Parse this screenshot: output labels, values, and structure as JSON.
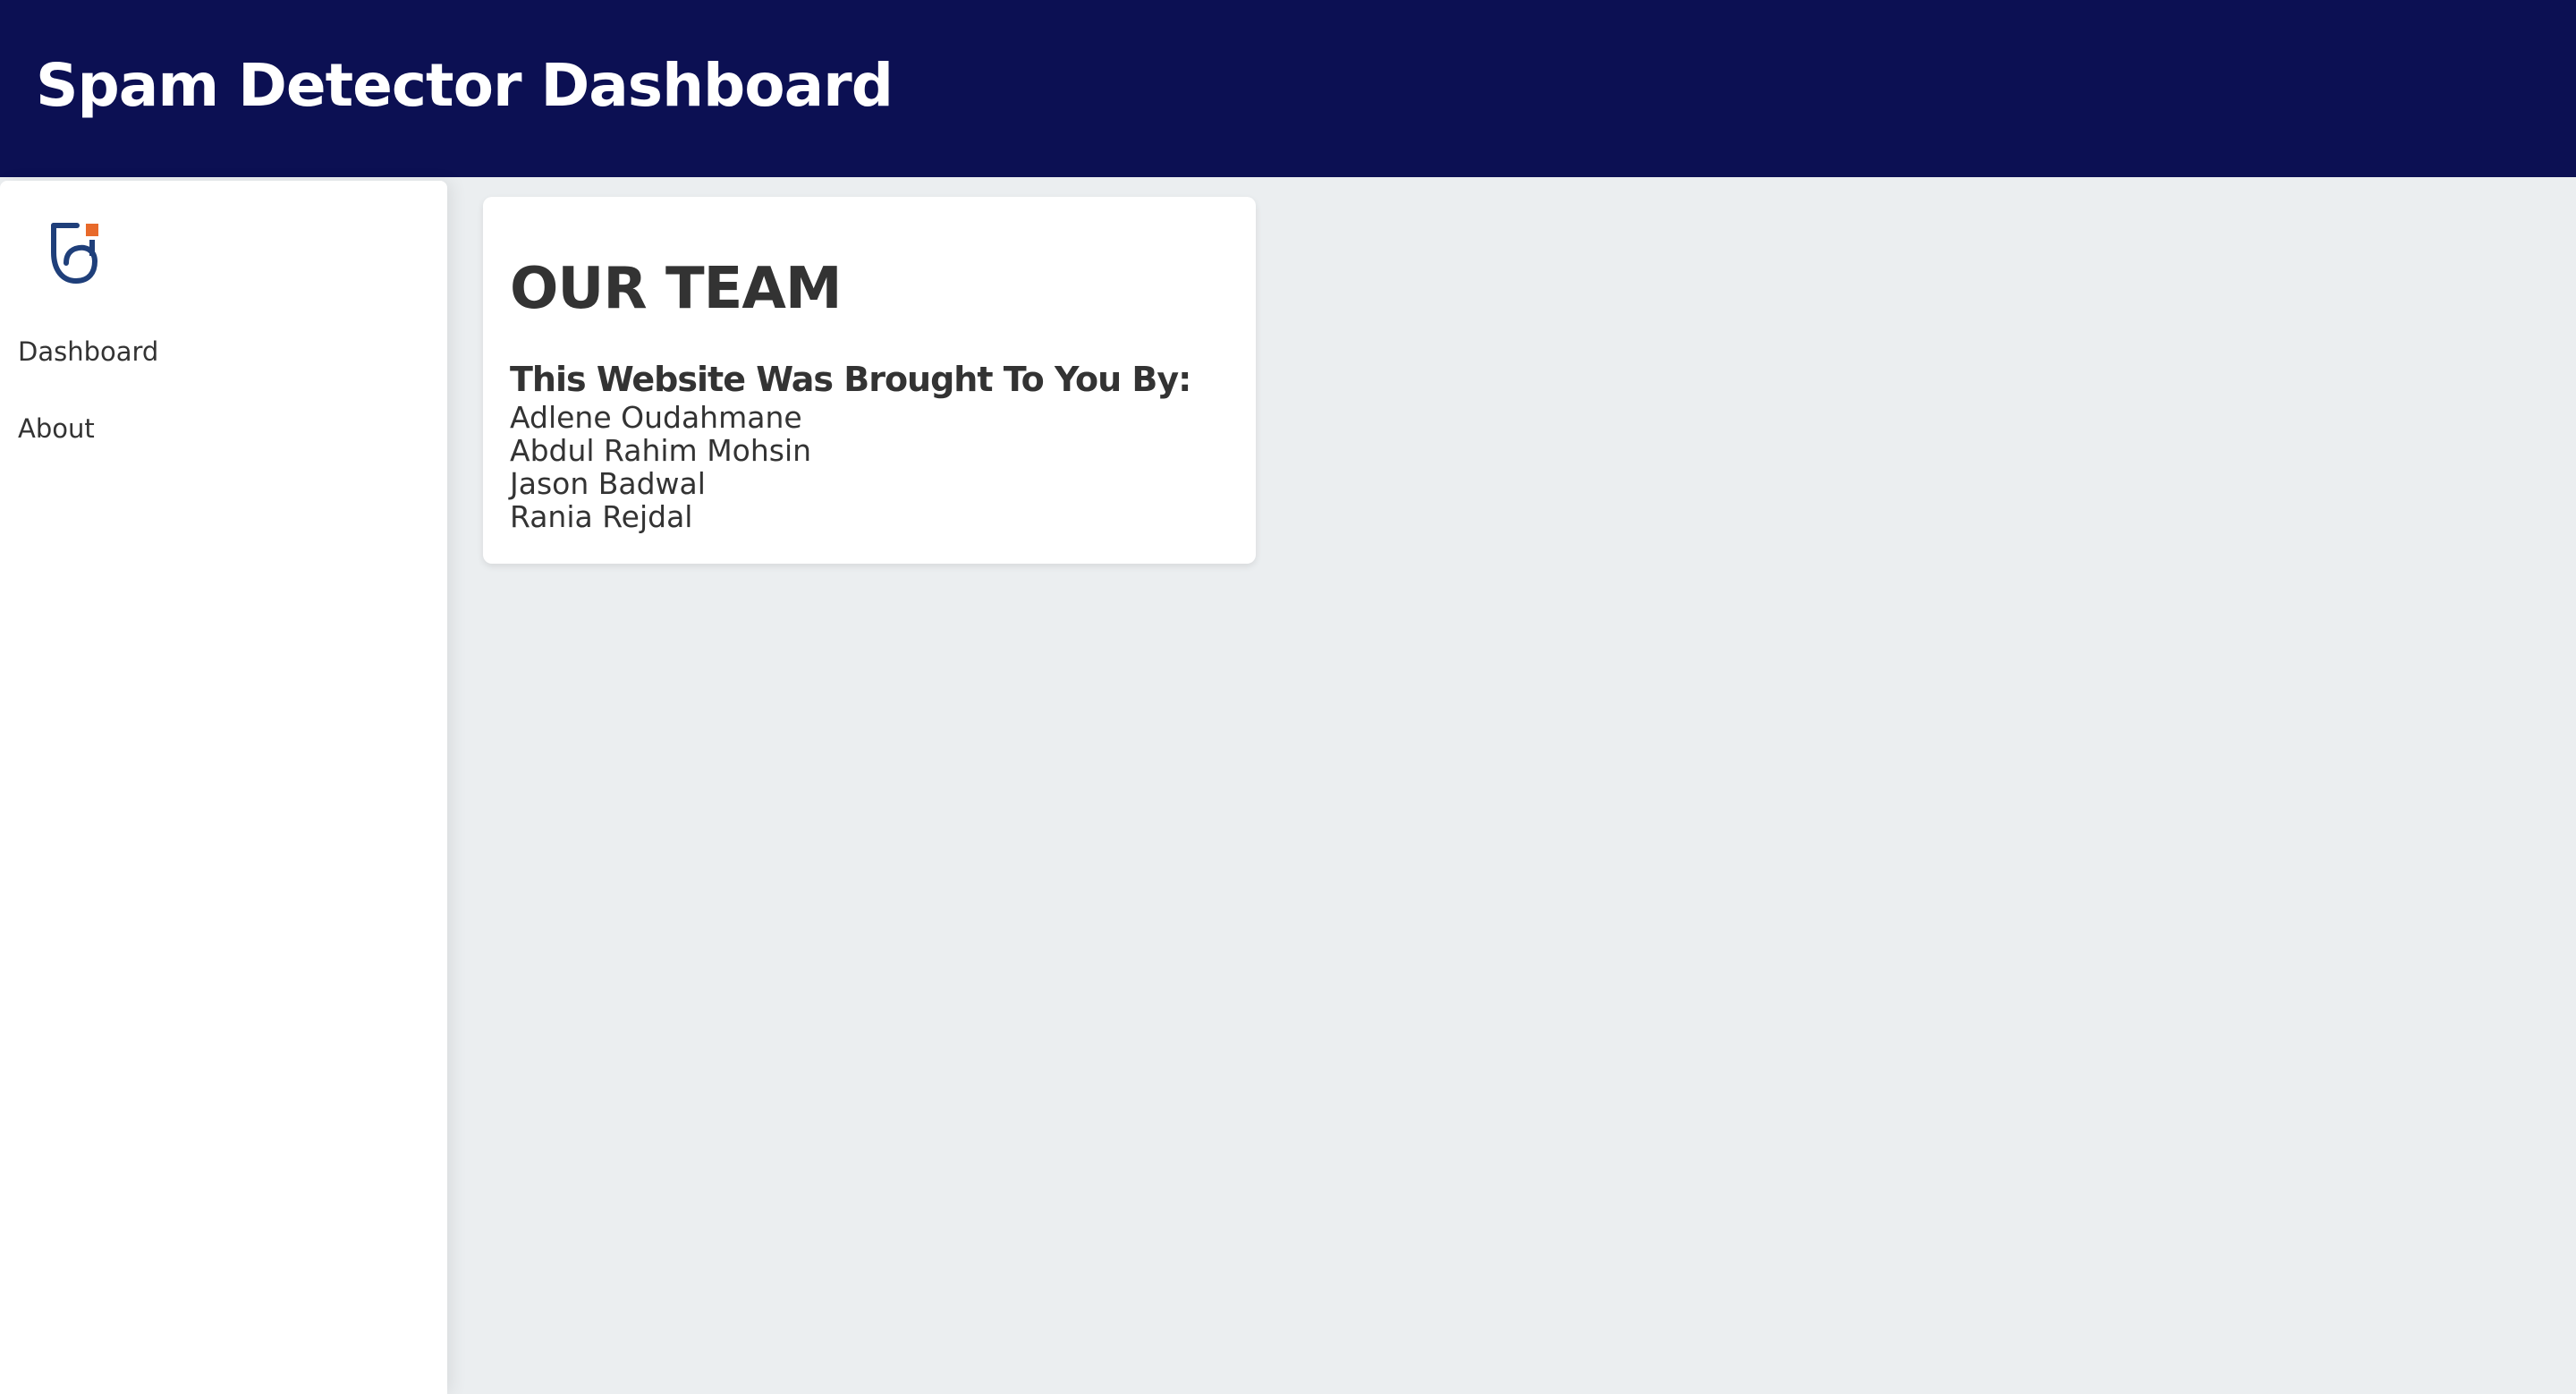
{
  "header": {
    "title": "Spam Detector Dashboard"
  },
  "sidebar": {
    "logo_icon": "brand-logo-icon",
    "items": [
      {
        "label": "Dashboard"
      },
      {
        "label": "About"
      }
    ]
  },
  "team_card": {
    "heading": "OUR TEAM",
    "subheading": "This Website Was Brought To You By:",
    "members": [
      "Adlene Oudahmane",
      "Abdul Rahim Mohsin",
      "Jason Badwal",
      "Rania Rejdal"
    ]
  },
  "colors": {
    "header_bg": "#0c1053",
    "page_bg": "#ebeef0",
    "text": "#333333",
    "logo_blue": "#1f3f7a",
    "logo_orange": "#e86a2b"
  }
}
